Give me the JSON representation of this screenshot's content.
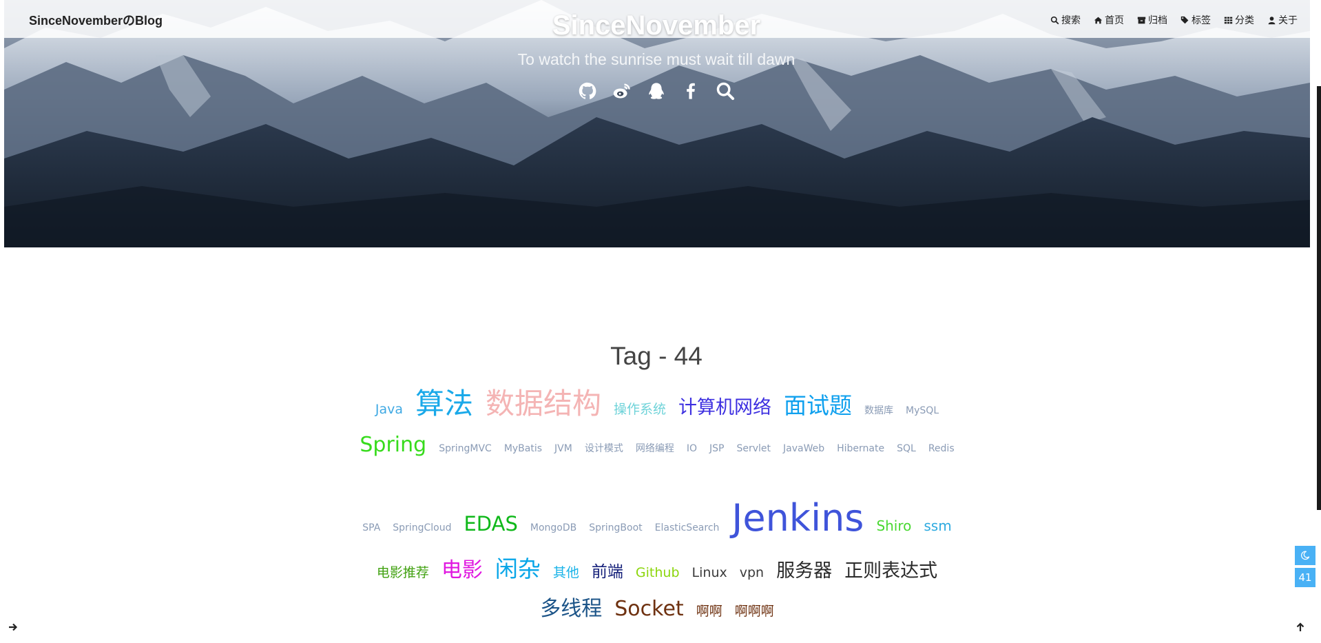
{
  "header": {
    "brand": "SinceNovemberのBlog",
    "site_title": "SinceNovember",
    "subtitle": "To watch the sunrise must wait till dawn"
  },
  "nav": [
    {
      "name": "search",
      "icon": "search-icon",
      "label": "搜索"
    },
    {
      "name": "home",
      "icon": "home-icon",
      "label": "首页"
    },
    {
      "name": "archive",
      "icon": "archive-icon",
      "label": "归档"
    },
    {
      "name": "tags",
      "icon": "tags-icon",
      "label": "标签"
    },
    {
      "name": "categories",
      "icon": "grid-icon",
      "label": "分类"
    },
    {
      "name": "about",
      "icon": "user-icon",
      "label": "关于"
    }
  ],
  "social": [
    "github-icon",
    "weibo-icon",
    "qq-icon",
    "facebook-icon",
    "search-icon"
  ],
  "tags_page": {
    "heading": "Tag - 44"
  },
  "tags": [
    {
      "label": "Java",
      "size": 19,
      "color": "#3fa9e3"
    },
    {
      "label": "算法",
      "size": 42,
      "color": "#1aa9e9"
    },
    {
      "label": "数据结构",
      "size": 42,
      "color": "#f4b4b4"
    },
    {
      "label": "操作系统",
      "size": 19,
      "color": "#6fd3d9"
    },
    {
      "label": "计算机网络",
      "size": 27,
      "color": "#3d2fe0"
    },
    {
      "label": "面试题",
      "size": 33,
      "color": "#0fa0ee"
    },
    {
      "label": "数据库",
      "size": 14,
      "color": "#8a9bb5"
    },
    {
      "label": "MySQL",
      "size": 14,
      "color": "#8a9bb5"
    },
    {
      "label": "Spring",
      "size": 30,
      "color": "#37db1c"
    },
    {
      "label": "SpringMVC",
      "size": 14,
      "color": "#8a9bb5"
    },
    {
      "label": "MyBatis",
      "size": 14,
      "color": "#8a9bb5"
    },
    {
      "label": "JVM",
      "size": 14,
      "color": "#8a9bb5"
    },
    {
      "label": "设计模式",
      "size": 14,
      "color": "#8a9bb5"
    },
    {
      "label": "网络编程",
      "size": 14,
      "color": "#8a9bb5"
    },
    {
      "label": "IO",
      "size": 14,
      "color": "#8a9bb5"
    },
    {
      "label": "JSP",
      "size": 14,
      "color": "#8a9bb5"
    },
    {
      "label": "Servlet",
      "size": 14,
      "color": "#8a9bb5"
    },
    {
      "label": "JavaWeb",
      "size": 14,
      "color": "#8a9bb5"
    },
    {
      "label": "Hibernate",
      "size": 14,
      "color": "#8a9bb5"
    },
    {
      "label": "SQL",
      "size": 14,
      "color": "#8a9bb5"
    },
    {
      "label": "Redis",
      "size": 14,
      "color": "#8a9bb5"
    },
    {
      "label": "SPA",
      "size": 14,
      "color": "#8a9bb5"
    },
    {
      "label": "SpringCloud",
      "size": 14,
      "color": "#8a9bb5"
    },
    {
      "label": "EDAS",
      "size": 29,
      "color": "#0fb81a"
    },
    {
      "label": "MongoDB",
      "size": 14,
      "color": "#8a9bb5"
    },
    {
      "label": "SpringBoot",
      "size": 14,
      "color": "#8a9bb5"
    },
    {
      "label": "ElasticSearch",
      "size": 14,
      "color": "#8a9bb5"
    },
    {
      "label": "Jenkins",
      "size": 54,
      "color": "#3f54da"
    },
    {
      "label": "Shiro",
      "size": 20,
      "color": "#49d831"
    },
    {
      "label": "ssm",
      "size": 20,
      "color": "#2daae0"
    },
    {
      "label": "电影推荐",
      "size": 19,
      "color": "#42a212"
    },
    {
      "label": "电影",
      "size": 30,
      "color": "#e018e0"
    },
    {
      "label": "闲杂",
      "size": 33,
      "color": "#08a6e8"
    },
    {
      "label": "其他",
      "size": 19,
      "color": "#1ab3e8"
    },
    {
      "label": "前端",
      "size": 23,
      "color": "#15207a"
    },
    {
      "label": "Github",
      "size": 19,
      "color": "#8cd60c"
    },
    {
      "label": "Linux",
      "size": 19,
      "color": "#3a3a3a"
    },
    {
      "label": "vpn",
      "size": 19,
      "color": "#3a3a3a"
    },
    {
      "label": "服务器",
      "size": 27,
      "color": "#2a2a2a"
    },
    {
      "label": "正则表达式",
      "size": 27,
      "color": "#2a2a2a"
    },
    {
      "label": "多线程",
      "size": 30,
      "color": "#1c5488"
    },
    {
      "label": "Socket",
      "size": 30,
      "color": "#6e3110"
    },
    {
      "label": "啊啊",
      "size": 19,
      "color": "#6e3110"
    },
    {
      "label": "啊啊啊",
      "size": 19,
      "color": "#6e3110"
    }
  ],
  "widgets": {
    "darkmode_icon": "moon-icon",
    "reading_progress": "41",
    "left_arrow_icon": "arrow-right-icon",
    "top_arrow_icon": "arrow-up-icon"
  }
}
